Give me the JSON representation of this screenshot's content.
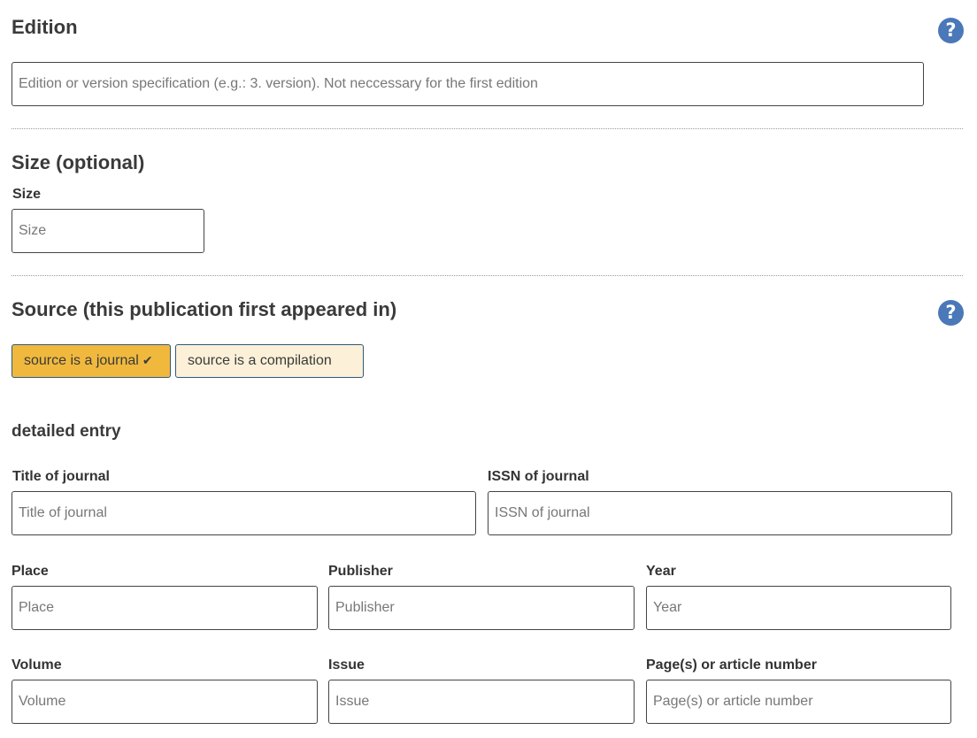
{
  "edition": {
    "title": "Edition",
    "help_icon": "question-mark-icon",
    "input_placeholder": "Edition or version specification (e.g.: 3. version). Not neccessary for the first edition",
    "input_value": ""
  },
  "size": {
    "title": "Size (optional)",
    "label": "Size",
    "input_placeholder": "Size",
    "input_value": ""
  },
  "source": {
    "title": "Source (this publication first appeared in)",
    "help_icon": "question-mark-icon",
    "toggle_journal_label": "source is a journal",
    "toggle_journal_check": "✔",
    "toggle_compilation_label": "source is a compilation",
    "selected": "journal",
    "detailed_entry_heading": "detailed entry",
    "fields": {
      "journal_title": {
        "label": "Title of journal",
        "placeholder": "Title of journal"
      },
      "issn": {
        "label": "ISSN of journal",
        "placeholder": "ISSN of journal"
      },
      "place": {
        "label": "Place",
        "placeholder": "Place"
      },
      "publisher": {
        "label": "Publisher",
        "placeholder": "Publisher"
      },
      "year": {
        "label": "Year",
        "placeholder": "Year"
      },
      "volume": {
        "label": "Volume",
        "placeholder": "Volume"
      },
      "issue": {
        "label": "Issue",
        "placeholder": "Issue"
      },
      "pages": {
        "label": "Page(s) or article number",
        "placeholder": "Page(s) or article number"
      }
    }
  },
  "colors": {
    "help_icon": "#4a78b8",
    "toggle_active": "#f0b93e",
    "toggle_inactive": "#fcf1d8",
    "toggle_border": "#2a5a80"
  }
}
